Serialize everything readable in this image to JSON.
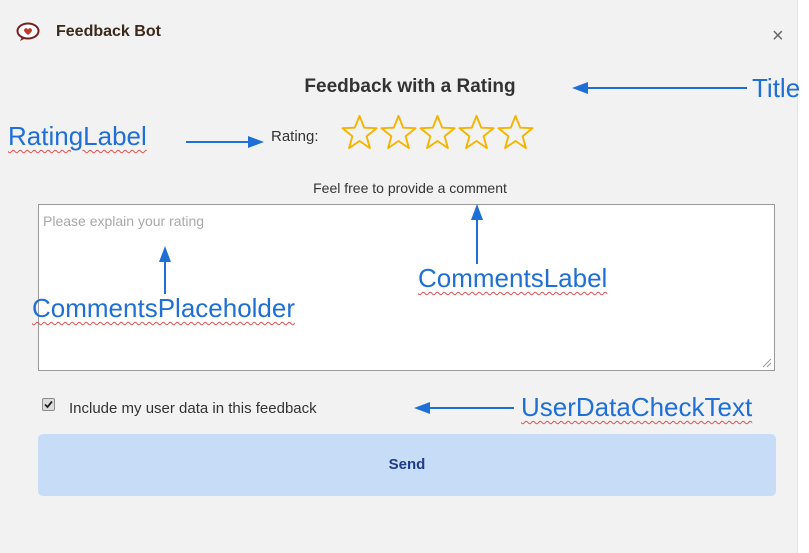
{
  "window": {
    "app_title": "Feedback Bot",
    "close_glyph": "×"
  },
  "form": {
    "title": "Feedback with a Rating",
    "rating_label": "Rating:",
    "rating_max": 5,
    "rating_value": 0,
    "comments_label": "Feel free to provide a comment",
    "comments_value": "",
    "comments_placeholder": "Please explain your rating",
    "user_data_checked": true,
    "user_data_check_text": "Include my user data in this feedback",
    "send_label": "Send"
  },
  "annotations": {
    "title": "Title",
    "rating_label": "RatingLabel",
    "comments_placeholder": "CommentsPlaceholder",
    "comments_label": "CommentsLabel",
    "user_data_check_text": "UserDataCheckText"
  },
  "icons": {
    "app": "speech-bubble-icon",
    "close": "close-icon",
    "star": "star-outline-icon",
    "check": "checkmark-icon"
  },
  "colors": {
    "window_bg": "#f2f2f2",
    "star_stroke": "#f5b400",
    "send_bg": "#c7dcf7",
    "send_text": "#1f3a8a",
    "annotation": "#1f6fd6",
    "spellcheck": "#e05050"
  }
}
